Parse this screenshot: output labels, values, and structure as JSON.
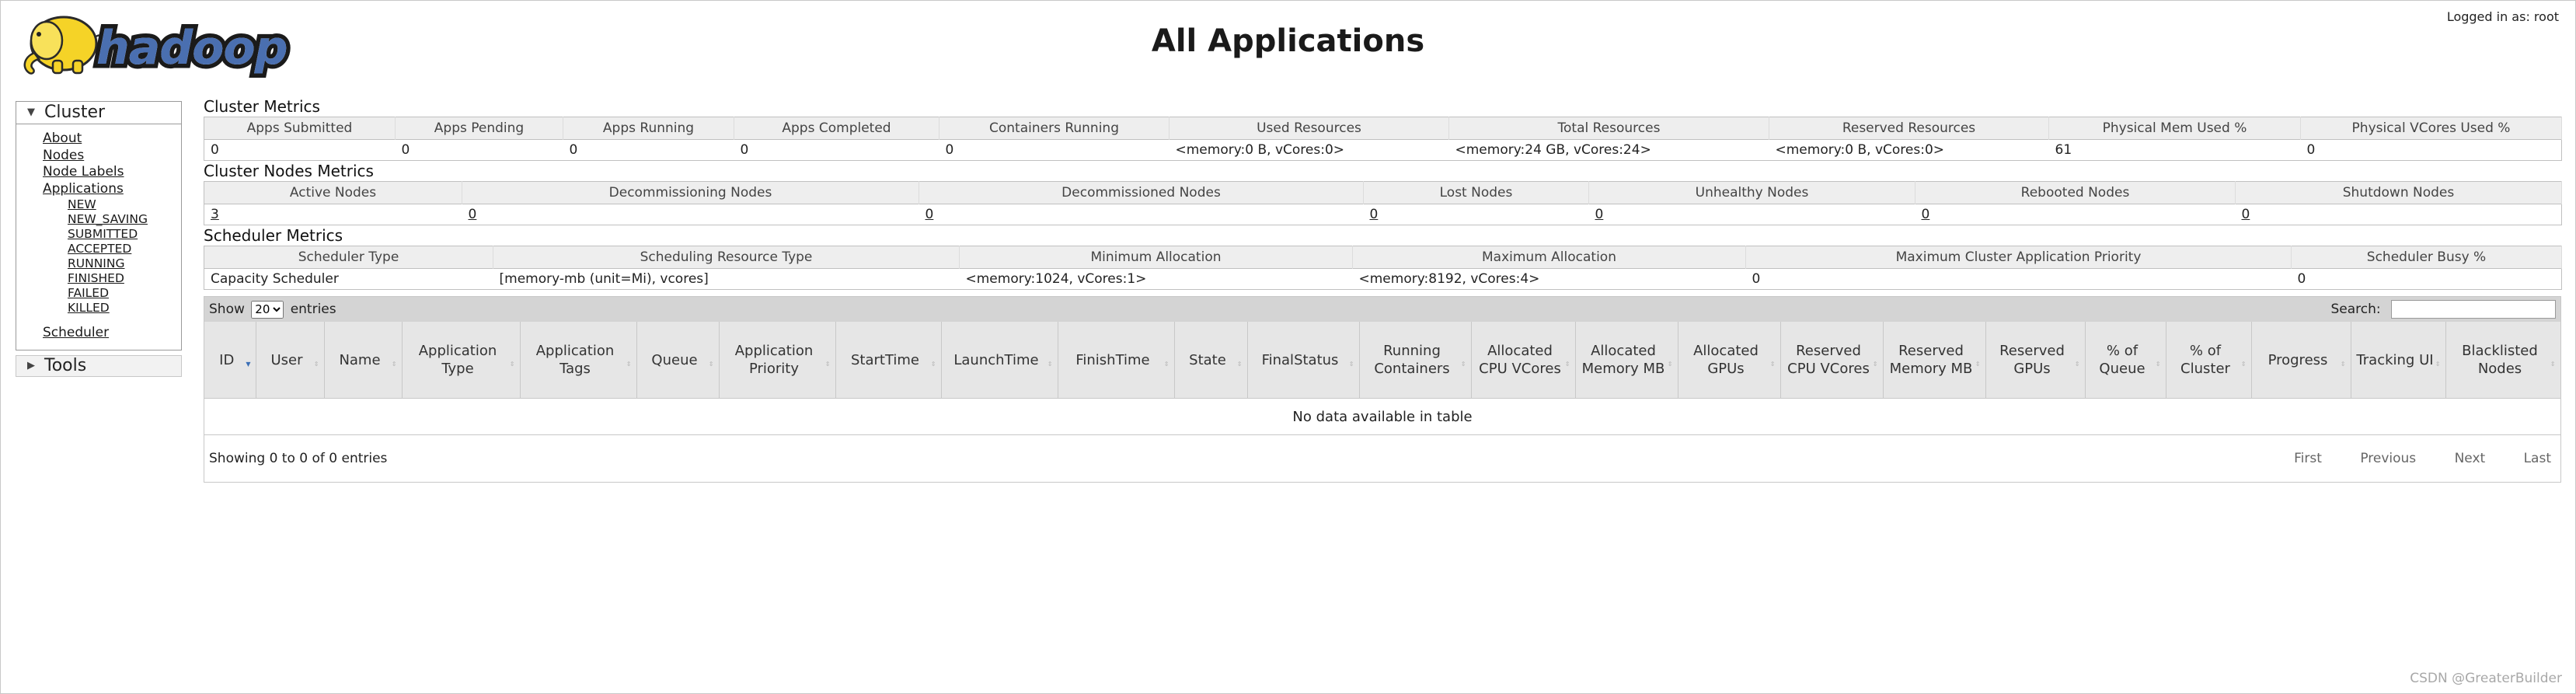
{
  "header": {
    "logo_text": "hadoop",
    "title": "All Applications",
    "login_text": "Logged in as: root"
  },
  "nav": {
    "cluster": {
      "label": "Cluster",
      "links": [
        "About",
        "Nodes",
        "Node Labels",
        "Applications"
      ],
      "app_states": [
        "NEW",
        "NEW_SAVING",
        "SUBMITTED",
        "ACCEPTED",
        "RUNNING",
        "FINISHED",
        "FAILED",
        "KILLED"
      ],
      "scheduler": "Scheduler"
    },
    "tools": {
      "label": "Tools"
    }
  },
  "cluster_metrics": {
    "title": "Cluster Metrics",
    "headers": [
      "Apps Submitted",
      "Apps Pending",
      "Apps Running",
      "Apps Completed",
      "Containers Running",
      "Used Resources",
      "Total Resources",
      "Reserved Resources",
      "Physical Mem Used %",
      "Physical VCores Used %"
    ],
    "values": [
      "0",
      "0",
      "0",
      "0",
      "0",
      "<memory:0 B, vCores:0>",
      "<memory:24 GB, vCores:24>",
      "<memory:0 B, vCores:0>",
      "61",
      "0"
    ]
  },
  "cluster_nodes_metrics": {
    "title": "Cluster Nodes Metrics",
    "headers": [
      "Active Nodes",
      "Decommissioning Nodes",
      "Decommissioned Nodes",
      "Lost Nodes",
      "Unhealthy Nodes",
      "Rebooted Nodes",
      "Shutdown Nodes"
    ],
    "values": [
      "3",
      "0",
      "0",
      "0",
      "0",
      "0",
      "0"
    ]
  },
  "scheduler_metrics": {
    "title": "Scheduler Metrics",
    "headers": [
      "Scheduler Type",
      "Scheduling Resource Type",
      "Minimum Allocation",
      "Maximum Allocation",
      "Maximum Cluster Application Priority",
      "Scheduler Busy %"
    ],
    "values": [
      "Capacity Scheduler",
      "[memory-mb (unit=Mi), vcores]",
      "<memory:1024, vCores:1>",
      "<memory:8192, vCores:4>",
      "0",
      "0"
    ]
  },
  "apps_table": {
    "show_label": "Show",
    "page_size": "20",
    "entries_label": "entries",
    "search_label": "Search:",
    "columns": [
      "ID",
      "User",
      "Name",
      "Application Type",
      "Application Tags",
      "Queue",
      "Application Priority",
      "StartTime",
      "LaunchTime",
      "FinishTime",
      "State",
      "FinalStatus",
      "Running Containers",
      "Allocated CPU VCores",
      "Allocated Memory MB",
      "Allocated GPUs",
      "Reserved CPU VCores",
      "Reserved Memory MB",
      "Reserved GPUs",
      "% of Queue",
      "% of Cluster",
      "Progress",
      "Tracking UI",
      "Blacklisted Nodes"
    ],
    "empty_message": "No data available in table",
    "info": "Showing 0 to 0 of 0 entries",
    "pager": [
      "First",
      "Previous",
      "Next",
      "Last"
    ]
  },
  "watermark": "CSDN @GreaterBuilder",
  "colors": {
    "header_bg": "#eeeeee",
    "controls_bg": "#d4d4d4",
    "sort_active": "#3b6fb6",
    "logo_yellow": "#f5d327"
  }
}
